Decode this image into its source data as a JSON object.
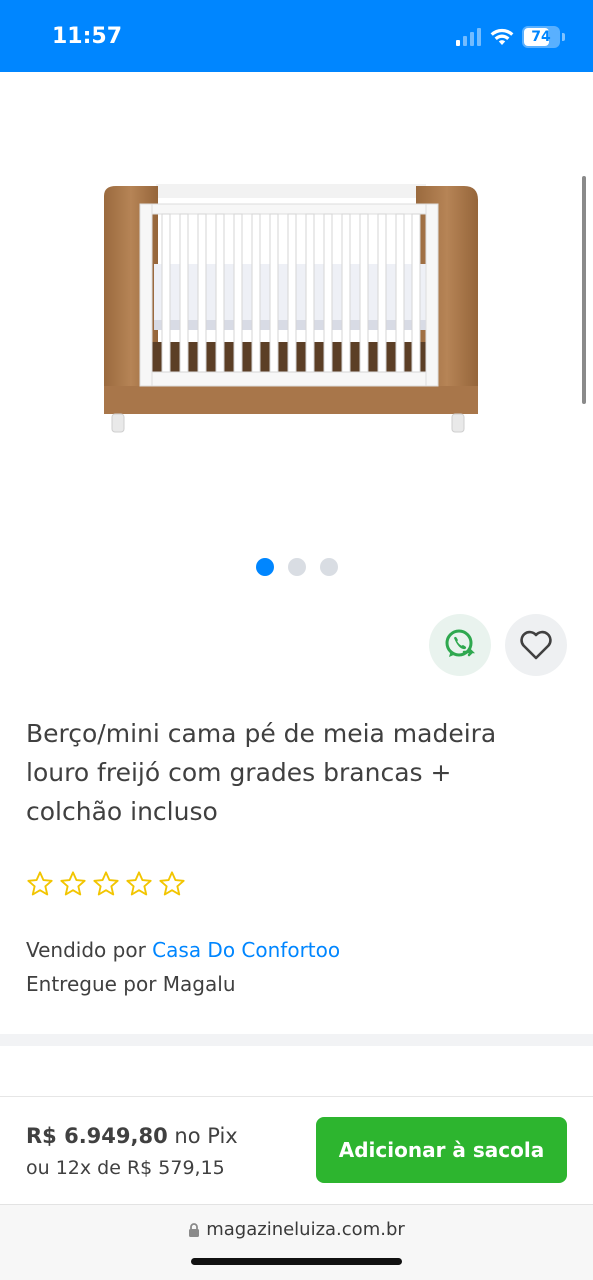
{
  "status_bar": {
    "time": "11:57",
    "battery_level": "74",
    "icons": [
      "signal-icon",
      "wifi-icon",
      "battery-charging-icon"
    ]
  },
  "product": {
    "image_alt": "crib-icon",
    "carousel": {
      "total": 3,
      "active": 1
    },
    "title": "Berço/mini cama pé de meia madeira louro freijó com grades brancas + colchão incluso",
    "rating_stars": 0,
    "rating_max": 5,
    "seller_prefix": "Vendido por",
    "seller_name": "Casa Do Confortoo",
    "delivery_prefix": "Entregue por",
    "delivery_name": "Magalu"
  },
  "actions": {
    "share_icon": "whatsapp-icon",
    "favorite_icon": "heart-icon"
  },
  "purchase": {
    "price": "R$ 6.949,80",
    "price_suffix": "no Pix",
    "installments": "ou 12x de R$ 579,15",
    "button_label": "Adicionar à sacola"
  },
  "browser": {
    "url": "magazineluiza.com.br",
    "lock_icon": "lock-icon"
  },
  "colors": {
    "brand_blue": "#0086ff",
    "cta_green": "#2db52f",
    "star_yellow": "#f2c500"
  }
}
